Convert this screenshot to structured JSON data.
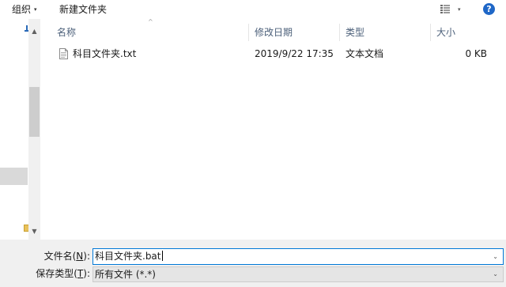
{
  "toolbar": {
    "organize_label": "组织",
    "organize_caret": "▾",
    "new_folder_label": "新建文件夹",
    "view_caret": "▾",
    "help_label": "?"
  },
  "nav": {
    "scroll_up": "▲",
    "scroll_down": "▼"
  },
  "list": {
    "sort_indicator": "^",
    "columns": {
      "name": "名称",
      "date": "修改日期",
      "type": "类型",
      "size": "大小"
    },
    "rows": [
      {
        "name": "科目文件夹.txt",
        "date": "2019/9/22 17:35",
        "type": "文本文档",
        "size": "0 KB"
      }
    ]
  },
  "bottom": {
    "filename_label_pre": "文件名(",
    "filename_label_key": "N",
    "filename_label_post": "):",
    "filename_value": "科目文件夹.bat",
    "filetype_label_pre": "保存类型(",
    "filetype_label_key": "T",
    "filetype_label_post": "):",
    "filetype_value": "所有文件  (*.*)",
    "dropdown_caret": "⌄"
  },
  "colors": {
    "help_blue": "#1f67c7",
    "input_focus_border": "#0078d7",
    "header_text": "#4c607a"
  }
}
